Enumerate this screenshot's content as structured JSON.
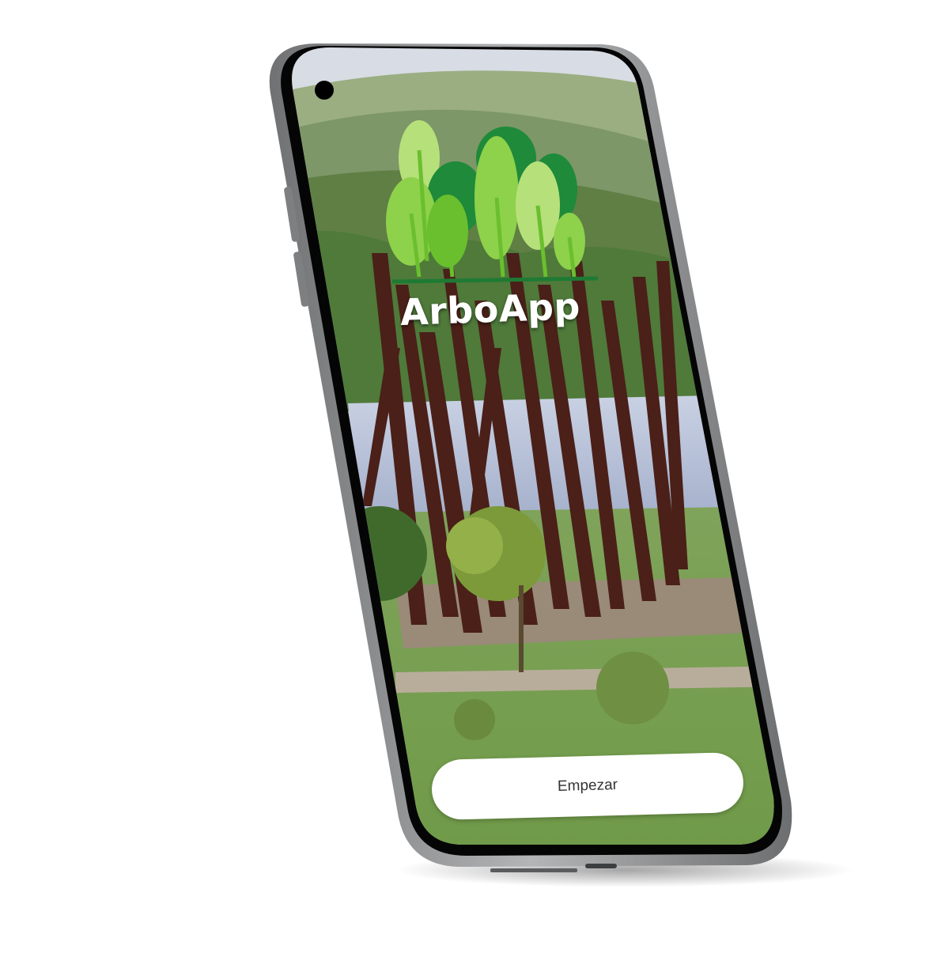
{
  "app": {
    "title": "ArboApp",
    "logo_icon": "tree-grove-icon"
  },
  "actions": {
    "start_label": "Empezar"
  },
  "device": {
    "frame_color": "#8f9193",
    "bezel_color": "#050505"
  },
  "theme": {
    "logo_greens": [
      "#6abf2e",
      "#8ed14a",
      "#1e8a3a",
      "#b6e07a"
    ],
    "ground_line": "#1f7a33",
    "title_color": "#ffffff",
    "button_bg": "#ffffff",
    "button_text": "#333333"
  }
}
